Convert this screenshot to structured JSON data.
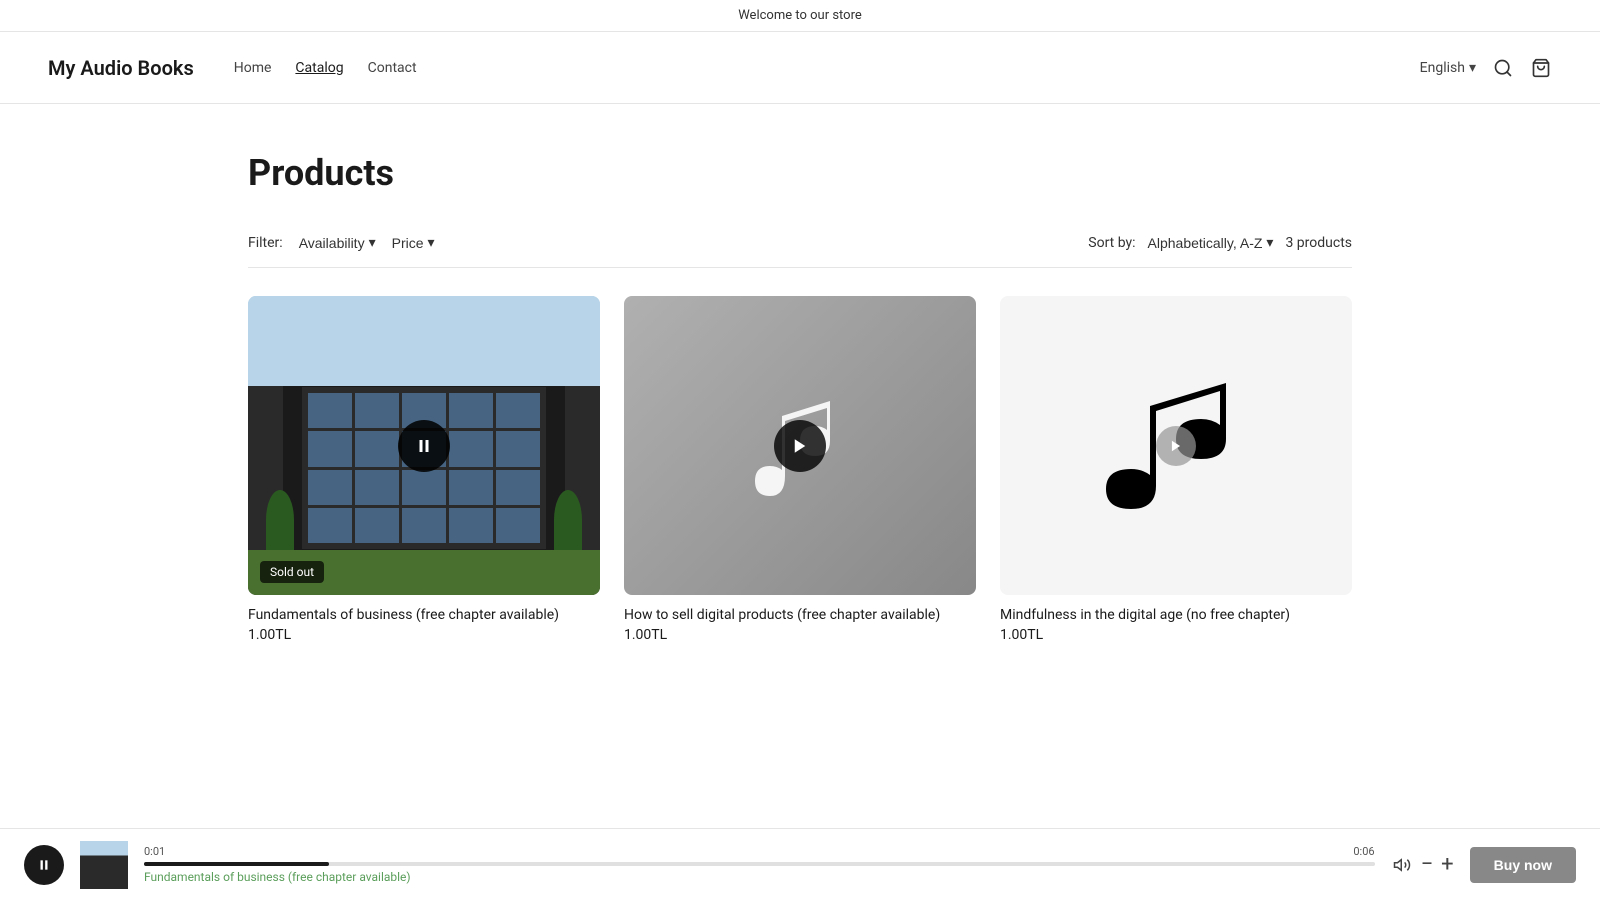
{
  "banner": {
    "text": "Welcome to our store"
  },
  "header": {
    "logo": "My Audio Books",
    "nav": [
      {
        "label": "Home",
        "active": false
      },
      {
        "label": "Catalog",
        "active": true
      },
      {
        "label": "Contact",
        "active": false
      }
    ],
    "language": "English",
    "search_label": "search",
    "cart_label": "cart"
  },
  "page": {
    "title": "Products"
  },
  "filters": {
    "label": "Filter:",
    "availability_label": "Availability",
    "price_label": "Price",
    "sort_label": "Sort by:",
    "sort_option": "Alphabetically, A-Z",
    "product_count": "3 products"
  },
  "products": [
    {
      "id": "product-1",
      "title": "Fundamentals of business (free chapter available)",
      "price": "1.00TL",
      "sold_out": true,
      "image_type": "building",
      "playing": true
    },
    {
      "id": "product-2",
      "title": "How to sell digital products (free chapter available)",
      "price": "1.00TL",
      "sold_out": false,
      "image_type": "music-dark",
      "playing": false
    },
    {
      "id": "product-3",
      "title": "Mindfulness in the digital age (no free chapter)",
      "price": "1.00TL",
      "sold_out": false,
      "image_type": "music-light",
      "playing": false
    }
  ],
  "player": {
    "track_name": "Fundamentals of business (free chapter available)",
    "current_time": "0:01",
    "total_time": "0:06",
    "buy_now_label": "Buy now"
  }
}
